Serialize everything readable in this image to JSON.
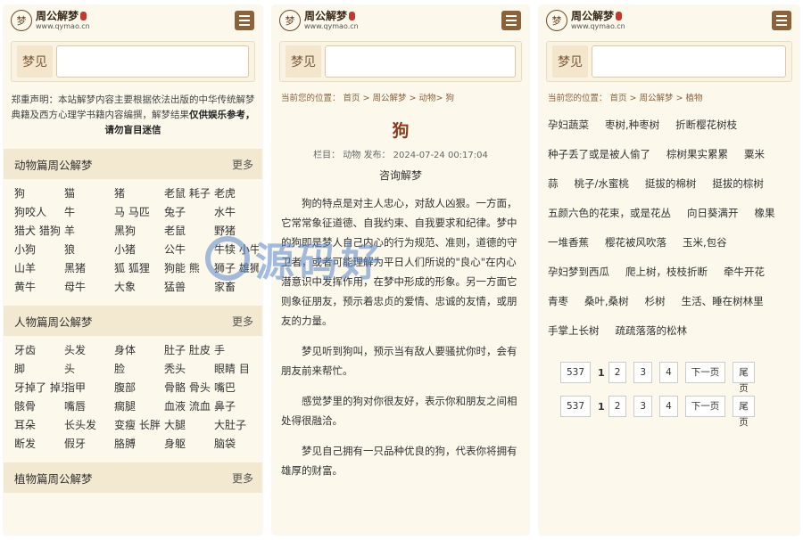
{
  "brand": {
    "logo_char": "梦",
    "name": "周公解梦",
    "url": "www.qymao.cn"
  },
  "search": {
    "label": "梦见"
  },
  "notice": {
    "text": "郑重声明：本站解梦内容主要根据依法出版的中华传统解梦典籍及西方心理学书籍内容编撰，解梦结果",
    "bold": "仅供娱乐参考，请勿盲目迷信"
  },
  "more": "更多",
  "sections": [
    {
      "title": "动物篇周公解梦",
      "items": [
        "狗",
        "猫",
        "猪",
        "老鼠 耗子",
        "老虎",
        "狗咬人",
        "牛",
        "马 马匹",
        "兔子",
        "水牛",
        "猎犬 猎狗",
        "羊",
        "黑狗",
        "老鼠",
        "野猪",
        "小狗",
        "狼",
        "小猪",
        "公牛",
        "牛犊 小牛",
        "山羊",
        "黑猪",
        "狐 狐狸",
        "狗能 熊",
        "狮子 雄狮",
        "黄牛",
        "母牛",
        "大象",
        "猛兽",
        "家畜"
      ]
    },
    {
      "title": "人物篇周公解梦",
      "items": [
        "牙齿",
        "头发",
        "身体",
        "肚子 肚皮",
        "手",
        "脚",
        "头",
        "脸",
        "秃头",
        "眼睛 目",
        "牙掉了 掉牙",
        "指甲",
        "腹部",
        "骨骼 骨头",
        "嘴巴",
        "骸骨",
        "嘴唇",
        "瘸腿",
        "血液 流血",
        "鼻子",
        "耳朵",
        "长头发",
        "变瘦 长胖",
        "大腿",
        "大肚子",
        "断发",
        "假牙",
        "胳膊",
        "身躯",
        "脑袋"
      ]
    },
    {
      "title": "植物篇周公解梦"
    }
  ],
  "article": {
    "breadcrumb": "当前您的位置： 首页 > 周公解梦 > 动物> 狗",
    "title": "狗",
    "meta": "栏目： 动物 发布： 2024-07-24 00:17:04",
    "subtitle": "咨询解梦",
    "paragraphs": [
      "狗的特点是对主人忠心，对敌人凶狠。一方面，它常常象征道德、自我约束、自我要求和纪律。梦中的狗即是梦人自己内心的行为规范、准则，道德的守卫者，或者可能理解为平日人们所说的\"良心\"在内心潜意识中发挥作用，在梦中形成的形象。另一方面它则象征朋友，预示着忠贞的爱情、忠诚的友情，或朋友的力量。",
      "梦见听到狗叫，预示当有敌人要骚扰你时，会有朋友前来帮忙。",
      "感觉梦里的狗对你很友好，表示你和朋友之间相处得很融洽。",
      "梦见自己拥有一只品种优良的狗，代表你将拥有雄厚的财富。"
    ]
  },
  "plant": {
    "breadcrumb": "当前您的位置： 首页 > 周公解梦 > 植物",
    "tags": [
      "孕妇蔬菜",
      "枣树,种枣树",
      "折断樱花树枝",
      "种子丢了或是被人偷了",
      "棕树果实累累",
      "粟米",
      "蒜",
      "桃子/水蜜桃",
      "挺拔的棉树",
      "挺拔的棕树",
      "五颜六色的花束，或是花丛",
      "向日葵满开",
      "橡果",
      "一堆香蕉",
      "樱花被风吹落",
      "玉米,包谷",
      "孕妇梦到西瓜",
      "爬上树，枝枝折断",
      "牵牛开花",
      "青枣",
      "桑叶,桑树",
      "杉树",
      "生活、睡在树林里",
      "手掌上长树",
      "疏疏落落的松林"
    ],
    "pager": {
      "total": "537",
      "current": "1",
      "pages": [
        "2",
        "3",
        "4"
      ],
      "next": "下一页",
      "last_a": "尾",
      "last_b": "页"
    }
  },
  "watermark": {
    "text": "源码好"
  }
}
